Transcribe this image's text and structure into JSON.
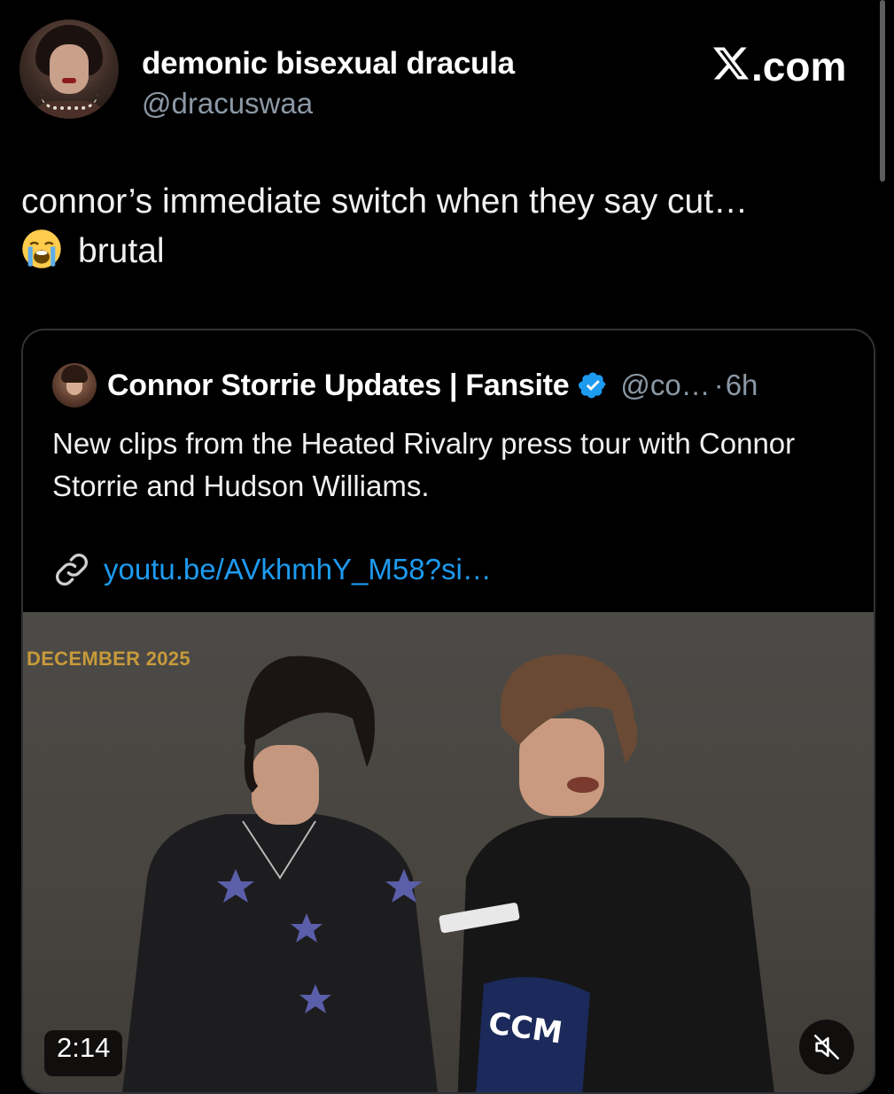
{
  "post": {
    "display_name": "demonic bisexual dracula",
    "handle": "@dracuswaa",
    "brand": ".com",
    "text": "connor’s immediate switch when they say cut…",
    "text_line2": "brutal",
    "emoji": "loudly-crying-face-emoji"
  },
  "quote": {
    "display_name": "Connor Storrie Updates | Fansite",
    "verified": true,
    "handle": "@co…",
    "separator": "·",
    "time": "6h",
    "text": "New clips from the Heated Rivalry press tour with Connor Storrie and Hudson Williams.",
    "link_text": "youtu.be/AVkhmhY_M58?si…",
    "media": {
      "overlay_label": "DECEMBER 2025",
      "duration": "2:14",
      "muted": true
    }
  },
  "colors": {
    "background": "#000000",
    "muted_text": "#8b98a5",
    "link": "#1d9bf0",
    "verified": "#1d9bf0",
    "overlay_label": "#c79a3a"
  }
}
